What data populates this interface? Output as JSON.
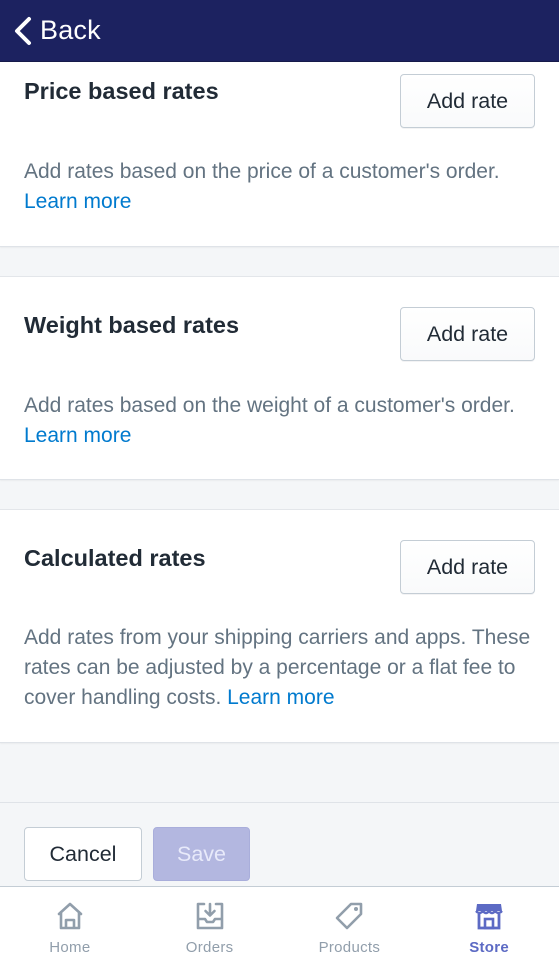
{
  "nav": {
    "back_label": "Back",
    "back_icon": "chevron-left-icon"
  },
  "sections": [
    {
      "title": "Price based rates",
      "button_label": "Add rate",
      "description": "Add rates based on the price of a customer's order.",
      "link_label": "Learn more"
    },
    {
      "title": "Weight based rates",
      "button_label": "Add rate",
      "description": "Add rates based on the weight of a customer's order.",
      "link_label": "Learn more"
    },
    {
      "title": "Calculated rates",
      "button_label": "Add rate",
      "description": "Add rates from your shipping carriers and apps. These rates can be adjusted by a percentage or a flat fee to cover handling costs.",
      "link_label": "Learn more"
    }
  ],
  "footer": {
    "cancel_label": "Cancel",
    "save_label": "Save",
    "save_enabled": false
  },
  "tabbar": {
    "items": [
      {
        "label": "Home",
        "icon": "home-icon",
        "active": false
      },
      {
        "label": "Orders",
        "icon": "orders-inbox-icon",
        "active": false
      },
      {
        "label": "Products",
        "icon": "tag-icon",
        "active": false
      },
      {
        "label": "Store",
        "icon": "store-icon",
        "active": true
      }
    ]
  },
  "colors": {
    "topbar": "#1c2260",
    "link": "#007ace",
    "accent": "#5c6ac4",
    "save_disabled": "#b3b7e0"
  }
}
